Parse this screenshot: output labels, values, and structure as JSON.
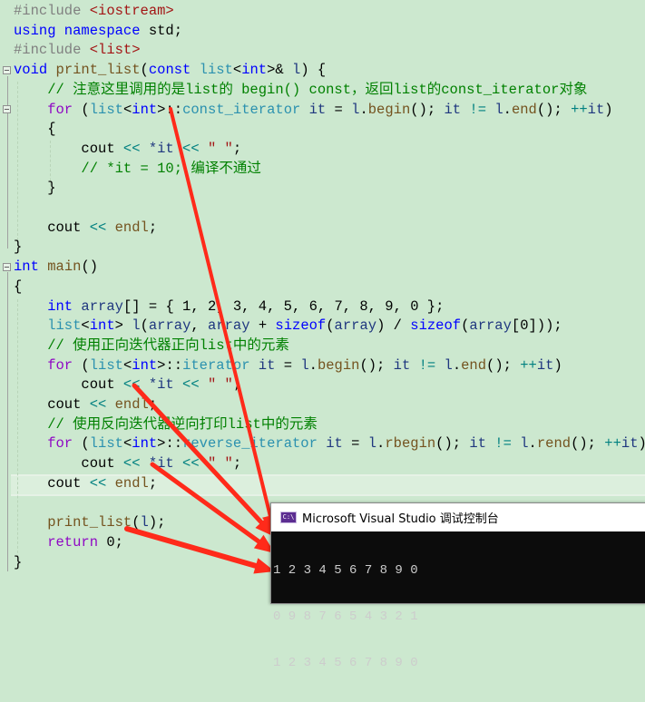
{
  "editor": {
    "lines": [
      {
        "tokens": [
          {
            "c": "pp",
            "t": "#include "
          },
          {
            "c": "inc",
            "t": "<iostream>"
          }
        ]
      },
      {
        "tokens": [
          {
            "c": "kw",
            "t": "using namespace "
          },
          {
            "c": "",
            "t": "std;"
          }
        ]
      },
      {
        "tokens": [
          {
            "c": "pp",
            "t": "#include "
          },
          {
            "c": "inc",
            "t": "<list>"
          }
        ]
      },
      {
        "tokens": [
          {
            "c": "kw",
            "t": "void "
          },
          {
            "c": "fn",
            "t": "print_list"
          },
          {
            "c": "",
            "t": "("
          },
          {
            "c": "kw",
            "t": "const "
          },
          {
            "c": "ty",
            "t": "list"
          },
          {
            "c": "",
            "t": "<"
          },
          {
            "c": "kw",
            "t": "int"
          },
          {
            "c": "",
            "t": ">& "
          },
          {
            "c": "var",
            "t": "l"
          },
          {
            "c": "",
            "t": ") {"
          }
        ]
      },
      {
        "tokens": [
          {
            "c": "cm",
            "t": "    // 注意这里调用的是list的 begin() const，返回list的const_iterator对象"
          }
        ]
      },
      {
        "tokens": [
          {
            "c": "kw2",
            "t": "    for "
          },
          {
            "c": "",
            "t": "("
          },
          {
            "c": "ty",
            "t": "list"
          },
          {
            "c": "",
            "t": "<"
          },
          {
            "c": "kw",
            "t": "int"
          },
          {
            "c": "",
            "t": ">::"
          },
          {
            "c": "ty",
            "t": "const_iterator "
          },
          {
            "c": "var",
            "t": "it"
          },
          {
            "c": "",
            "t": " = "
          },
          {
            "c": "var",
            "t": "l"
          },
          {
            "c": "",
            "t": "."
          },
          {
            "c": "mem",
            "t": "begin"
          },
          {
            "c": "",
            "t": "(); "
          },
          {
            "c": "var",
            "t": "it"
          },
          {
            "c": "op",
            "t": " != "
          },
          {
            "c": "var",
            "t": "l"
          },
          {
            "c": "",
            "t": "."
          },
          {
            "c": "mem",
            "t": "end"
          },
          {
            "c": "",
            "t": "(); "
          },
          {
            "c": "op",
            "t": "++"
          },
          {
            "c": "var",
            "t": "it"
          },
          {
            "c": "",
            "t": ")"
          }
        ]
      },
      {
        "tokens": [
          {
            "c": "",
            "t": "    {"
          }
        ]
      },
      {
        "tokens": [
          {
            "c": "",
            "t": "        cout "
          },
          {
            "c": "op",
            "t": "<< "
          },
          {
            "c": "var",
            "t": "*it "
          },
          {
            "c": "op",
            "t": "<< "
          },
          {
            "c": "str",
            "t": "\" \""
          },
          {
            "c": "",
            "t": ";"
          }
        ]
      },
      {
        "tokens": [
          {
            "c": "cm",
            "t": "        // *it = 10; 编译不通过"
          }
        ]
      },
      {
        "tokens": [
          {
            "c": "",
            "t": "    }"
          }
        ]
      },
      {
        "tokens": [
          {
            "c": "",
            "t": ""
          }
        ]
      },
      {
        "tokens": [
          {
            "c": "",
            "t": "    cout "
          },
          {
            "c": "op",
            "t": "<< "
          },
          {
            "c": "mem",
            "t": "endl"
          },
          {
            "c": "",
            "t": ";"
          }
        ]
      },
      {
        "tokens": [
          {
            "c": "",
            "t": "}"
          }
        ]
      },
      {
        "tokens": [
          {
            "c": "kw",
            "t": "int "
          },
          {
            "c": "fn",
            "t": "main"
          },
          {
            "c": "",
            "t": "()"
          }
        ]
      },
      {
        "tokens": [
          {
            "c": "",
            "t": "{"
          }
        ]
      },
      {
        "tokens": [
          {
            "c": "kw",
            "t": "    int "
          },
          {
            "c": "var",
            "t": "array"
          },
          {
            "c": "",
            "t": "[] = { 1, 2, 3, 4, 5, 6, 7, 8, 9, 0 };"
          }
        ]
      },
      {
        "tokens": [
          {
            "c": "ty",
            "t": "    list"
          },
          {
            "c": "",
            "t": "<"
          },
          {
            "c": "kw",
            "t": "int"
          },
          {
            "c": "",
            "t": "> "
          },
          {
            "c": "var",
            "t": "l"
          },
          {
            "c": "",
            "t": "("
          },
          {
            "c": "var",
            "t": "array"
          },
          {
            "c": "",
            "t": ", "
          },
          {
            "c": "var",
            "t": "array"
          },
          {
            "c": "",
            "t": " + "
          },
          {
            "c": "kw",
            "t": "sizeof"
          },
          {
            "c": "",
            "t": "("
          },
          {
            "c": "var",
            "t": "array"
          },
          {
            "c": "",
            "t": ") / "
          },
          {
            "c": "kw",
            "t": "sizeof"
          },
          {
            "c": "",
            "t": "("
          },
          {
            "c": "var",
            "t": "array"
          },
          {
            "c": "",
            "t": "[0]));"
          }
        ]
      },
      {
        "tokens": [
          {
            "c": "cm",
            "t": "    // 使用正向迭代器正向list中的元素"
          }
        ]
      },
      {
        "tokens": [
          {
            "c": "kw2",
            "t": "    for "
          },
          {
            "c": "",
            "t": "("
          },
          {
            "c": "ty",
            "t": "list"
          },
          {
            "c": "",
            "t": "<"
          },
          {
            "c": "kw",
            "t": "int"
          },
          {
            "c": "",
            "t": ">::"
          },
          {
            "c": "ty",
            "t": "iterator "
          },
          {
            "c": "var",
            "t": "it"
          },
          {
            "c": "",
            "t": " = "
          },
          {
            "c": "var",
            "t": "l"
          },
          {
            "c": "",
            "t": "."
          },
          {
            "c": "mem",
            "t": "begin"
          },
          {
            "c": "",
            "t": "(); "
          },
          {
            "c": "var",
            "t": "it"
          },
          {
            "c": "op",
            "t": " != "
          },
          {
            "c": "var",
            "t": "l"
          },
          {
            "c": "",
            "t": "."
          },
          {
            "c": "mem",
            "t": "end"
          },
          {
            "c": "",
            "t": "(); "
          },
          {
            "c": "op",
            "t": "++"
          },
          {
            "c": "var",
            "t": "it"
          },
          {
            "c": "",
            "t": ")"
          }
        ]
      },
      {
        "tokens": [
          {
            "c": "",
            "t": "        cout "
          },
          {
            "c": "op",
            "t": "<< "
          },
          {
            "c": "var",
            "t": "*it "
          },
          {
            "c": "op",
            "t": "<< "
          },
          {
            "c": "str",
            "t": "\" \""
          },
          {
            "c": "",
            "t": ";"
          }
        ]
      },
      {
        "tokens": [
          {
            "c": "",
            "t": "    cout "
          },
          {
            "c": "op",
            "t": "<< "
          },
          {
            "c": "mem",
            "t": "endl"
          },
          {
            "c": "",
            "t": ";"
          }
        ]
      },
      {
        "tokens": [
          {
            "c": "cm",
            "t": "    // 使用反向迭代器逆向打印list中的元素"
          }
        ]
      },
      {
        "tokens": [
          {
            "c": "kw2",
            "t": "    for "
          },
          {
            "c": "",
            "t": "("
          },
          {
            "c": "ty",
            "t": "list"
          },
          {
            "c": "",
            "t": "<"
          },
          {
            "c": "kw",
            "t": "int"
          },
          {
            "c": "",
            "t": ">::"
          },
          {
            "c": "ty",
            "t": "reverse_iterator "
          },
          {
            "c": "var",
            "t": "it"
          },
          {
            "c": "",
            "t": " = "
          },
          {
            "c": "var",
            "t": "l"
          },
          {
            "c": "",
            "t": "."
          },
          {
            "c": "mem",
            "t": "rbegin"
          },
          {
            "c": "",
            "t": "(); "
          },
          {
            "c": "var",
            "t": "it"
          },
          {
            "c": "op",
            "t": " != "
          },
          {
            "c": "var",
            "t": "l"
          },
          {
            "c": "",
            "t": "."
          },
          {
            "c": "mem",
            "t": "rend"
          },
          {
            "c": "",
            "t": "(); "
          },
          {
            "c": "op",
            "t": "++"
          },
          {
            "c": "var",
            "t": "it"
          },
          {
            "c": "",
            "t": ")"
          }
        ]
      },
      {
        "tokens": [
          {
            "c": "",
            "t": "        cout "
          },
          {
            "c": "op",
            "t": "<< "
          },
          {
            "c": "var",
            "t": "*it "
          },
          {
            "c": "op",
            "t": "<< "
          },
          {
            "c": "str",
            "t": "\" \""
          },
          {
            "c": "",
            "t": ";"
          }
        ]
      },
      {
        "tokens": [
          {
            "c": "",
            "t": "    cout "
          },
          {
            "c": "op",
            "t": "<< "
          },
          {
            "c": "mem",
            "t": "endl"
          },
          {
            "c": "",
            "t": ";"
          }
        ]
      },
      {
        "tokens": [
          {
            "c": "",
            "t": ""
          }
        ]
      },
      {
        "tokens": [
          {
            "c": "fn",
            "t": "    print_list"
          },
          {
            "c": "",
            "t": "("
          },
          {
            "c": "var",
            "t": "l"
          },
          {
            "c": "",
            "t": ");"
          }
        ]
      },
      {
        "tokens": [
          {
            "c": "kw2",
            "t": "    return "
          },
          {
            "c": "",
            "t": "0;"
          }
        ]
      },
      {
        "tokens": [
          {
            "c": "",
            "t": "}"
          }
        ]
      }
    ],
    "current_line_index": 24
  },
  "console": {
    "icon_label": "C:\\",
    "title": "Microsoft Visual Studio 调试控制台",
    "output_lines": [
      "1 2 3 4 5 6 7 8 9 0",
      "0 9 8 7 6 5 4 3 2 1",
      "1 2 3 4 5 6 7 8 9 0"
    ]
  },
  "annotations": {
    "arrow_color": "#ff2a1a"
  }
}
